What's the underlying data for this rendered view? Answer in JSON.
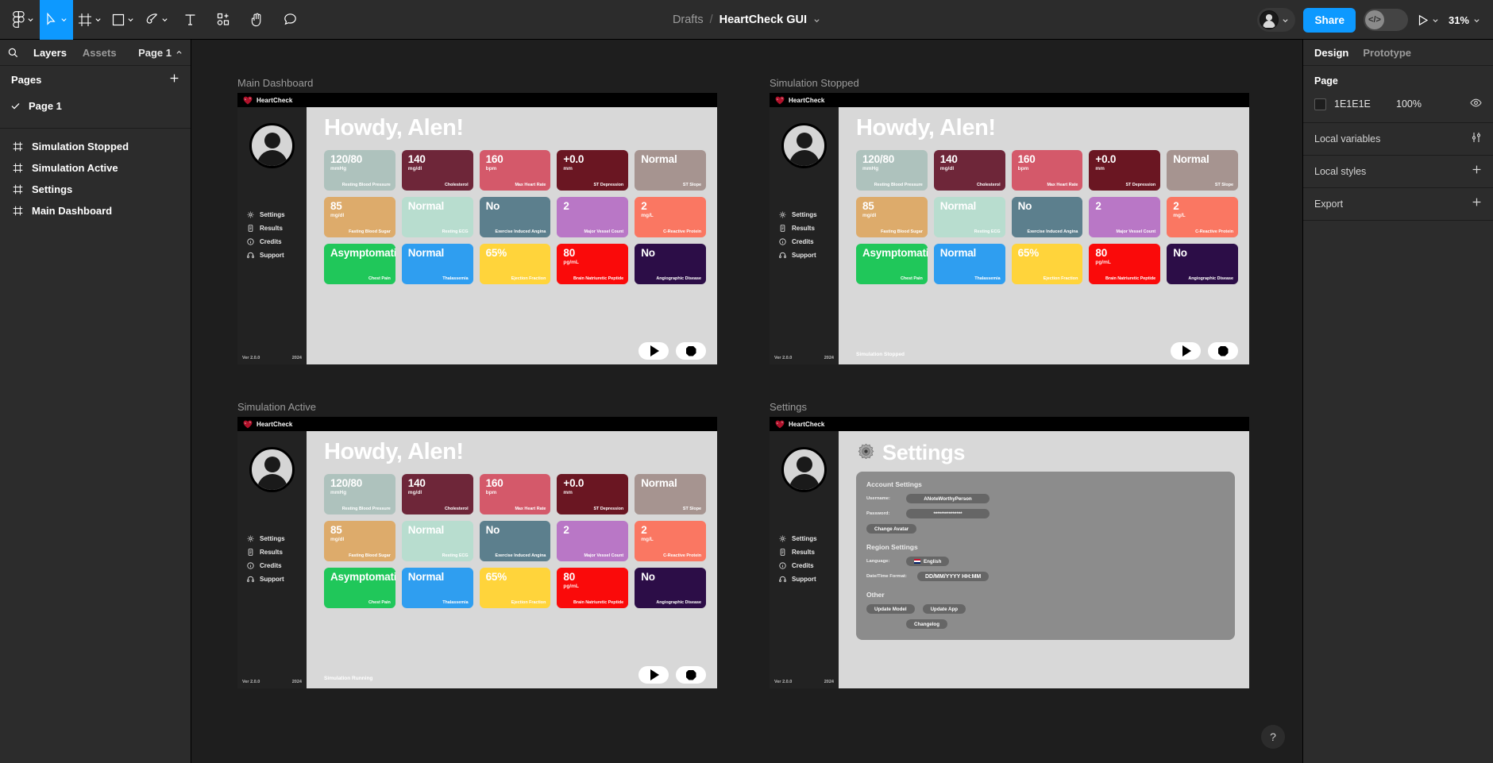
{
  "topbar": {
    "menu_icon": "figma-logo-icon",
    "tools": [
      {
        "name": "move-tool",
        "icon": "cursor-icon",
        "active": true
      },
      {
        "name": "frame-tool",
        "icon": "frame-icon",
        "active": false
      },
      {
        "name": "shape-tool",
        "icon": "square-icon",
        "active": false
      },
      {
        "name": "pen-tool",
        "icon": "pen-icon",
        "active": false
      },
      {
        "name": "text-tool",
        "icon": "text-icon",
        "active": false
      },
      {
        "name": "actions-tool",
        "icon": "plugin-icon",
        "active": false
      },
      {
        "name": "hand-tool",
        "icon": "hand-icon",
        "active": false
      },
      {
        "name": "comment-tool",
        "icon": "comment-icon",
        "active": false
      }
    ],
    "breadcrumb_project": "Drafts",
    "breadcrumb_sep": "/",
    "breadcrumb_file": "HeartCheck GUI",
    "share_label": "Share",
    "code_glyph": "</>",
    "zoom_label": "31%"
  },
  "left_panel": {
    "tab_layers": "Layers",
    "tab_assets": "Assets",
    "page_selector": "Page 1",
    "pages_header": "Pages",
    "pages": [
      {
        "label": "Page 1",
        "selected": true
      }
    ],
    "layers": [
      {
        "label": "Simulation Stopped",
        "icon": "frame-icon"
      },
      {
        "label": "Simulation Active",
        "icon": "frame-icon"
      },
      {
        "label": "Settings",
        "icon": "frame-icon"
      },
      {
        "label": "Main Dashboard",
        "icon": "frame-icon"
      }
    ]
  },
  "right_panel": {
    "tab_design": "Design",
    "tab_prototype": "Prototype",
    "page_section_title": "Page",
    "page_fill_hex": "1E1E1E",
    "page_fill_opacity": "100%",
    "rows": [
      {
        "label": "Local variables",
        "action": "variables-icon"
      },
      {
        "label": "Local styles",
        "action": "plus-icon"
      },
      {
        "label": "Export",
        "action": "plus-icon"
      }
    ]
  },
  "canvas": {
    "background_color": "#1e1e1e",
    "help_glyph": "?"
  },
  "app": {
    "brand": "HeartCheck",
    "greeting": "Howdy, Alen!",
    "sidebar_nav": [
      {
        "label": "Settings",
        "icon": "gear-icon"
      },
      {
        "label": "Results",
        "icon": "document-icon"
      },
      {
        "label": "Credits",
        "icon": "info-icon"
      },
      {
        "label": "Support",
        "icon": "headset-icon"
      }
    ],
    "version": "Ver 2.0.0",
    "year": "2024",
    "metric_cards": [
      {
        "value": "120/80",
        "unit": "mmHg",
        "caption": "Resting Blood Pressure",
        "color": "#aec2bd"
      },
      {
        "value": "140",
        "unit": "mg/dl",
        "caption": "Cholesterol",
        "color": "#6e2639"
      },
      {
        "value": "160",
        "unit": "bpm",
        "caption": "Max Heart Rate",
        "color": "#d4596a"
      },
      {
        "value": "+0.0",
        "unit": "mm",
        "caption": "ST Depression",
        "color": "#6a1622"
      },
      {
        "value": "Normal",
        "unit": "",
        "caption": "ST Slope",
        "color": "#a69490"
      },
      {
        "value": "85",
        "unit": "mg/dl",
        "caption": "Fasting Blood Sugar",
        "color": "#ddab6b"
      },
      {
        "value": "Normal",
        "unit": "",
        "caption": "Resting ECG",
        "color": "#b8ddcf"
      },
      {
        "value": "No",
        "unit": "",
        "caption": "Exercise Induced Angina",
        "color": "#5c7f8d"
      },
      {
        "value": "2",
        "unit": "",
        "caption": "Major Vessel Count",
        "color": "#b977c6"
      },
      {
        "value": "2",
        "unit": "mg/L",
        "caption": "C-Reactive Protein",
        "color": "#fa7762"
      },
      {
        "value": "Asymptomatic",
        "unit": "",
        "caption": "Chest Pain",
        "color": "#20c75a"
      },
      {
        "value": "Normal",
        "unit": "",
        "caption": "Thalassemia",
        "color": "#2f9ef0"
      },
      {
        "value": "65%",
        "unit": "",
        "caption": "Ejection Fraction",
        "color": "#ffd43b"
      },
      {
        "value": "80",
        "unit": "pg/mL",
        "caption": "Brain Natriuretic Peptide",
        "color": "#fa0a0a"
      },
      {
        "value": "No",
        "unit": "",
        "caption": "Angiographic Disease",
        "color": "#2c0d47"
      }
    ],
    "controls": {
      "play": "play-icon",
      "stop": "stop-icon"
    }
  },
  "frames": [
    {
      "name": "Main Dashboard",
      "label": "Main Dashboard",
      "status": ""
    },
    {
      "name": "Simulation Stopped",
      "label": "Simulation Stopped",
      "status": "Simulation Stopped"
    },
    {
      "name": "Simulation Active",
      "label": "Simulation Active",
      "status": "Simulation Running"
    },
    {
      "name": "Settings",
      "label": "Settings",
      "status": ""
    }
  ],
  "settings_screen": {
    "title": "Settings",
    "gear_icon": "gear-icon",
    "account_section": "Account Settings",
    "username_label": "Username:",
    "username_value": "ANoteWorthyPerson",
    "password_label": "Password:",
    "password_value": "***************",
    "change_avatar_button": "Change Avatar",
    "region_section": "Region Settings",
    "language_label": "Language:",
    "language_value": "English",
    "language_flag": "uk-flag-icon",
    "datetime_label": "Date/Time  Format:",
    "datetime_value": "DD/MM/YYYY    HH:MM",
    "other_section": "Other",
    "update_model_button": "Update Model",
    "update_app_button": "Update App",
    "changelog_button": "Changelog"
  }
}
